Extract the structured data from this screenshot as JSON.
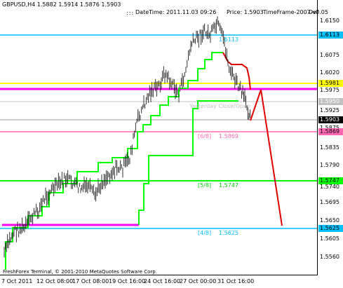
{
  "header": {
    "symbol_line": "GBPUSD,H4  1.5882 1.5914 1.5876 1.5903",
    "dots": ":::",
    "datetime": "DateTime: 2011.11.03 09:26",
    "price": "Price: 1.5903",
    "timeframe": "TimeFrame-2007-v0.05",
    "def": "Def"
  },
  "levels": {
    "l68": {
      "label": "[6/8]",
      "value": "1.5869"
    },
    "l58": {
      "label": "[5/8]",
      "value": "1.5747"
    },
    "l48": {
      "label": "[4/8]",
      "value": "1.5625"
    },
    "l_top_value": "1.6113",
    "yesterday_close": "Yesterday Close/Open"
  },
  "price_tags": {
    "cyan_top": "1.6113",
    "yellow": "1.5981",
    "gray": "1.5950",
    "current": "1.5903",
    "pink": "1.5869",
    "green": "1.5747",
    "cyan_bottom": "1.5625"
  },
  "y_ticks": [
    "1.6150",
    "1.6075",
    "1.6020",
    "1.5975",
    "1.5925",
    "1.5875",
    "1.5835",
    "1.5790",
    "1.5740",
    "1.5695",
    "1.5650",
    "1.5605",
    "1.5560"
  ],
  "x_ticks": [
    "7 Oct 2011",
    "12 Oct 08:00",
    "17 Oct 08:00",
    "19 Oct 16:00",
    "24 Oct 16:00",
    "27 Oct 00:00",
    "31 Oct 16:00"
  ],
  "copyright": "FreshForex Terminal, © 2001-2010 MetaQuotes Software Corp.",
  "colors": {
    "cyan": "#00bfff",
    "yellow": "#ffff00",
    "pink": "#ff69b4",
    "magenta": "#ff00ff",
    "green": "#00ff00",
    "red": "#e00000",
    "gray": "#c0c0c0"
  }
}
